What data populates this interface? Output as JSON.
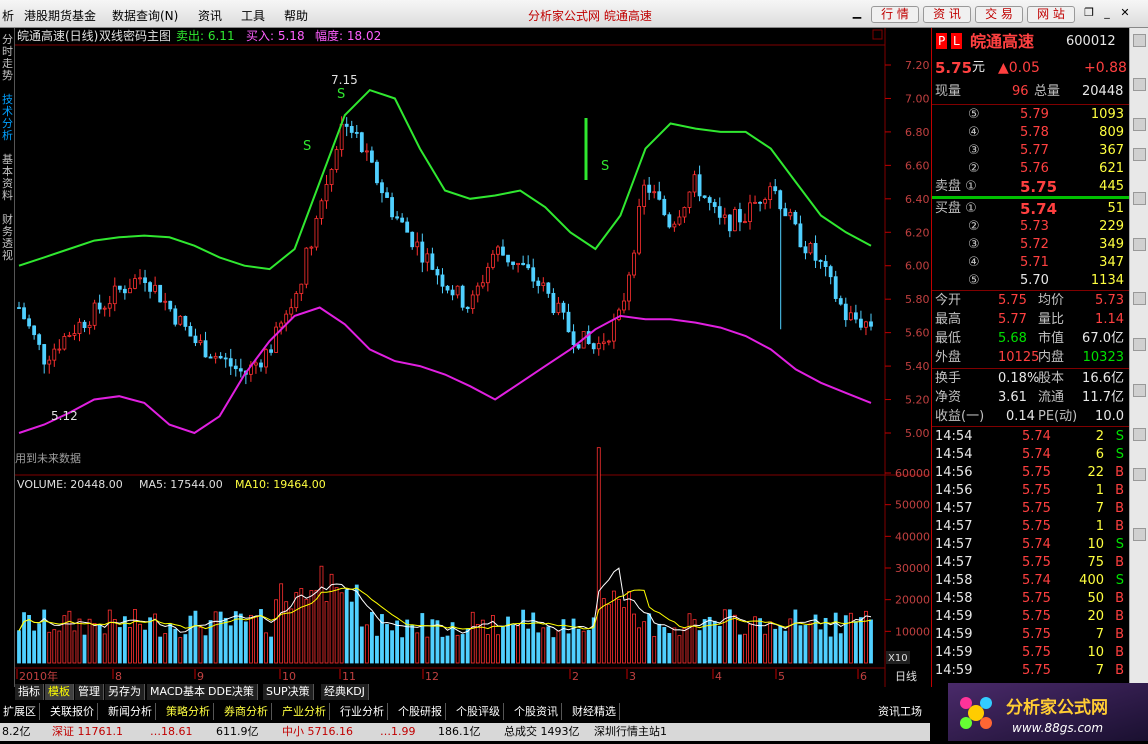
{
  "menubar": {
    "items": [
      "析",
      "港股期货基金",
      "数据查询(N)",
      "资讯",
      "工具",
      "帮助"
    ],
    "title": "分析家公式网 皖通高速",
    "buttons": [
      "行 情",
      "资 讯",
      "交 易",
      "网 站"
    ]
  },
  "sidetabs": [
    "分时走势",
    "技术分析",
    "基本资料",
    "财务透视"
  ],
  "chart": {
    "header_stock": "皖通高速(日线)",
    "header_formula": "双线密码主图",
    "sell_label": "卖出: 6.11",
    "buy_label": "买入: 5.18",
    "range_label": "幅度: 18.02",
    "high_mark": "7.15",
    "low_mark": "5.12",
    "future_note": "用到未来数据",
    "price_ticks": [
      "7.20",
      "7.00",
      "6.80",
      "6.60",
      "6.40",
      "6.20",
      "6.00",
      "5.80",
      "5.60",
      "5.40",
      "5.20",
      "5.00"
    ],
    "vol_label": "VOLUME: 20448.00",
    "ma5_label": "MA5: 17544.00",
    "ma10_label": "MA10: 19464.00",
    "vol_ticks": [
      "60000",
      "50000",
      "40000",
      "30000",
      "20000",
      "10000"
    ],
    "vol_unit": "X10",
    "period": "日线",
    "date_labels": [
      "2010年",
      "8",
      "9",
      "10",
      "11",
      "12",
      "2",
      "3",
      "4",
      "5",
      "6"
    ],
    "signal_s": "S"
  },
  "chart_data": {
    "type": "candlestick",
    "price_range": [
      4.95,
      7.3
    ],
    "volume_range": [
      0,
      65000
    ],
    "upper_band": [
      6.0,
      6.05,
      6.1,
      6.15,
      6.17,
      6.18,
      6.17,
      6.12,
      6.05,
      6.0,
      5.98,
      6.1,
      6.5,
      6.9,
      7.05,
      7.0,
      6.7,
      6.45,
      6.4,
      6.42,
      6.45,
      6.35,
      6.2,
      6.1,
      6.3,
      6.7,
      6.85,
      6.82,
      6.8,
      6.8,
      6.7,
      6.5,
      6.3,
      6.2,
      6.12
    ],
    "lower_band": [
      5.0,
      5.05,
      5.12,
      5.2,
      5.22,
      5.18,
      5.05,
      5.0,
      5.1,
      5.35,
      5.55,
      5.7,
      5.75,
      5.65,
      5.5,
      5.43,
      5.4,
      5.35,
      5.28,
      5.2,
      5.3,
      5.4,
      5.5,
      5.62,
      5.7,
      5.68,
      5.68,
      5.66,
      5.63,
      5.58,
      5.5,
      5.38,
      5.3,
      5.24,
      5.18
    ],
    "closes": [
      5.75,
      5.45,
      5.6,
      5.72,
      5.85,
      5.95,
      5.75,
      5.55,
      5.45,
      5.35,
      5.5,
      5.8,
      6.35,
      6.9,
      6.6,
      6.3,
      6.1,
      5.9,
      5.75,
      6.1,
      6.0,
      5.85,
      5.6,
      5.5,
      5.7,
      6.5,
      6.25,
      6.5,
      6.25,
      6.3,
      6.5,
      6.2,
      6.0,
      5.7,
      5.65
    ]
  },
  "quote": {
    "name": "皖通高速",
    "code": "600012",
    "price": "5.75",
    "price_unit": "元",
    "change": "▲0.05",
    "change_pct": "+0.88",
    "now_vol_label": "现量",
    "now_vol": "96",
    "total_label": "总量",
    "total": "20448",
    "sell_levels": [
      {
        "n": "⑤",
        "p": "5.79",
        "v": "1093"
      },
      {
        "n": "④",
        "p": "5.78",
        "v": "809"
      },
      {
        "n": "③",
        "p": "5.77",
        "v": "367"
      },
      {
        "n": "②",
        "p": "5.76",
        "v": "621"
      },
      {
        "n": "卖盘 ①",
        "p": "5.75",
        "v": "445"
      }
    ],
    "buy_levels": [
      {
        "n": "买盘 ①",
        "p": "5.74",
        "v": "51"
      },
      {
        "n": "②",
        "p": "5.73",
        "v": "229"
      },
      {
        "n": "③",
        "p": "5.72",
        "v": "349"
      },
      {
        "n": "④",
        "p": "5.71",
        "v": "347"
      },
      {
        "n": "⑤",
        "p": "5.70",
        "v": "1134"
      }
    ],
    "stats": [
      {
        "l1": "今开",
        "v1": "5.75",
        "l2": "均价",
        "v2": "5.73"
      },
      {
        "l1": "最高",
        "v1": "5.77",
        "l2": "量比",
        "v2": "1.14"
      },
      {
        "l1": "最低",
        "v1": "5.68",
        "l2": "市值",
        "v2": "67.0亿"
      },
      {
        "l1": "外盘",
        "v1": "10125",
        "l2": "内盘",
        "v2": "10323"
      }
    ],
    "fin": [
      {
        "l1": "换手",
        "v1": "0.18%",
        "l2": "股本",
        "v2": "16.6亿"
      },
      {
        "l1": "净资",
        "v1": "3.61",
        "l2": "流通",
        "v2": "11.7亿"
      },
      {
        "l1": "收益(一)",
        "v1": "0.14",
        "l2": "PE(动)",
        "v2": "10.0"
      }
    ],
    "ticks": [
      {
        "t": "14:54",
        "p": "5.74",
        "v": "2",
        "d": "S"
      },
      {
        "t": "14:54",
        "p": "5.74",
        "v": "6",
        "d": "S"
      },
      {
        "t": "14:56",
        "p": "5.75",
        "v": "22",
        "d": "B"
      },
      {
        "t": "14:56",
        "p": "5.75",
        "v": "1",
        "d": "B"
      },
      {
        "t": "14:57",
        "p": "5.75",
        "v": "7",
        "d": "B"
      },
      {
        "t": "14:57",
        "p": "5.75",
        "v": "1",
        "d": "B"
      },
      {
        "t": "14:57",
        "p": "5.74",
        "v": "10",
        "d": "S"
      },
      {
        "t": "14:57",
        "p": "5.75",
        "v": "75",
        "d": "B"
      },
      {
        "t": "14:58",
        "p": "5.74",
        "v": "400",
        "d": "S"
      },
      {
        "t": "14:58",
        "p": "5.75",
        "v": "50",
        "d": "B"
      },
      {
        "t": "14:59",
        "p": "5.75",
        "v": "20",
        "d": "B"
      },
      {
        "t": "14:59",
        "p": "5.75",
        "v": "7",
        "d": "B"
      },
      {
        "t": "14:59",
        "p": "5.75",
        "v": "10",
        "d": "B"
      },
      {
        "t": "14:59",
        "p": "5.75",
        "v": "7",
        "d": "B"
      }
    ]
  },
  "bottom": {
    "tabs": [
      "指标",
      "模板",
      "管理",
      "另存为",
      "MACD基本",
      "DDE决策",
      "SUP决策",
      "经典KDJ"
    ],
    "func_tabs": [
      "扩展区",
      "关联报价",
      "新闻分析",
      "策略分析",
      "券商分析",
      "产业分析",
      "行业分析",
      "个股研报",
      "个股评级",
      "个股资讯",
      "财经精选"
    ],
    "right_label": "资讯工场",
    "status": [
      "8.2亿",
      "深证 11761.1",
      "…18.61",
      "611.9亿",
      "中小 5716.16",
      "…1.99",
      "186.1亿",
      "总成交 1493亿",
      "深圳行情主站1"
    ]
  },
  "logo": {
    "text": "分析家公式网",
    "url": "www.88gs.com"
  }
}
